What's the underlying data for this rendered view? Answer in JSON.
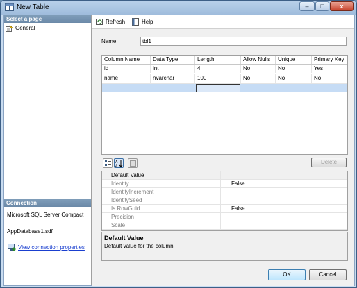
{
  "window": {
    "title": "New Table",
    "minimize": "–",
    "maximize": "□",
    "close": "x"
  },
  "left": {
    "select_page": "Select a page",
    "pages": [
      {
        "label": "General"
      }
    ],
    "connection_header": "Connection",
    "server": "Microsoft SQL Server Compact",
    "database": "AppDatabase1.sdf",
    "view_connection": "View connection properties"
  },
  "toolbar": {
    "refresh": "Refresh",
    "help": "Help"
  },
  "name": {
    "label": "Name:",
    "value": "tbl1"
  },
  "grid": {
    "headers": [
      "Column Name",
      "Data Type",
      "Length",
      "Allow Nulls",
      "Unique",
      "Primary Key"
    ],
    "rows": [
      [
        "id",
        "int",
        "4",
        "No",
        "No",
        "Yes"
      ],
      [
        "name",
        "nvarchar",
        "100",
        "No",
        "No",
        "No"
      ]
    ]
  },
  "delete_button": "Delete",
  "properties": {
    "category": "Default Value",
    "items": [
      {
        "name": "Identity",
        "value": "False"
      },
      {
        "name": "IdentityIncrement",
        "value": ""
      },
      {
        "name": "IdentitySeed",
        "value": ""
      },
      {
        "name": "Is RowGuid",
        "value": "False"
      },
      {
        "name": "Precision",
        "value": ""
      },
      {
        "name": "Scale",
        "value": ""
      }
    ]
  },
  "description": {
    "title": "Default Value",
    "text": "Default value for the column"
  },
  "ok_button": "OK",
  "cancel_button": "Cancel"
}
